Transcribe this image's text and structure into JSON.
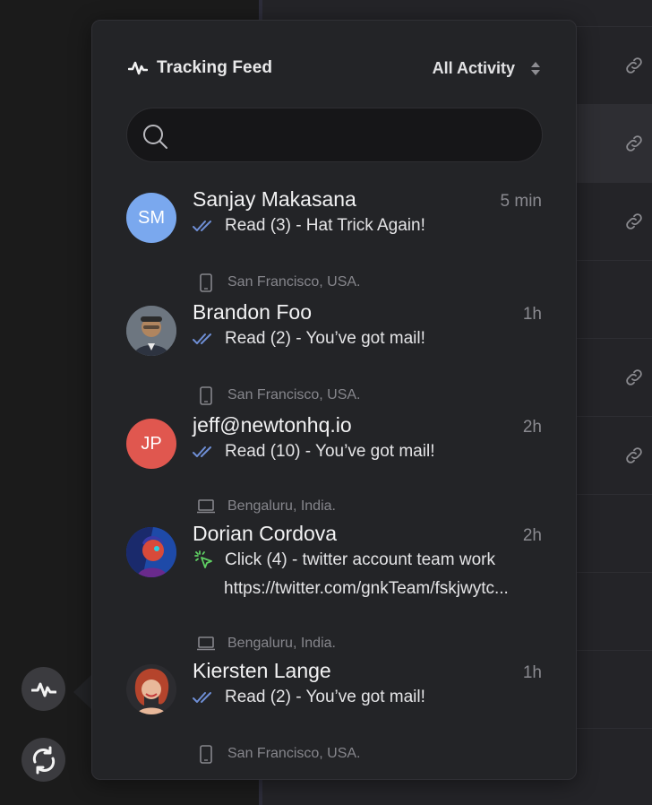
{
  "feed": {
    "title": "Tracking Feed",
    "filter_label": "All Activity",
    "search": {
      "placeholder": "",
      "value": ""
    }
  },
  "colors": {
    "read_check": "#6f8fd6",
    "click_cursor": "#5fcf63",
    "accent_avatar_sm": "#7aa8ee",
    "accent_avatar_jp": "#e0574f"
  },
  "items": [
    {
      "name": "Sanjay Makasana",
      "time": "5 min",
      "action": "Read (3) - Hat Trick Again!",
      "action_icon": "double-check-icon",
      "location": "San Francisco, USA.",
      "device_icon": "phone-icon",
      "avatar_initials": "SM"
    },
    {
      "name": "Brandon Foo",
      "time": "1h",
      "action": "Read (2) - You’ve got mail!",
      "action_icon": "double-check-icon",
      "location": "San Francisco, USA.",
      "device_icon": "phone-icon",
      "avatar_initials": ""
    },
    {
      "name": "jeff@newtonhq.io",
      "time": "2h",
      "action": "Read (10) - You’ve got mail!",
      "action_icon": "double-check-icon",
      "location": "Bengaluru, India.",
      "device_icon": "laptop-icon",
      "avatar_initials": "JP"
    },
    {
      "name": "Dorian Cordova",
      "time": "2h",
      "action": "Click (4) - twitter account team work",
      "url": "https://twitter.com/gnkTeam/fskjwytc...",
      "action_icon": "click-cursor-icon",
      "location": "Bengaluru, India.",
      "device_icon": "laptop-icon",
      "avatar_initials": ""
    },
    {
      "name": "Kiersten Lange",
      "time": "1h",
      "action": "Read (2) - You’ve got mail!",
      "action_icon": "double-check-icon",
      "location": "San Francisco, USA.",
      "device_icon": "phone-icon",
      "avatar_initials": ""
    }
  ]
}
